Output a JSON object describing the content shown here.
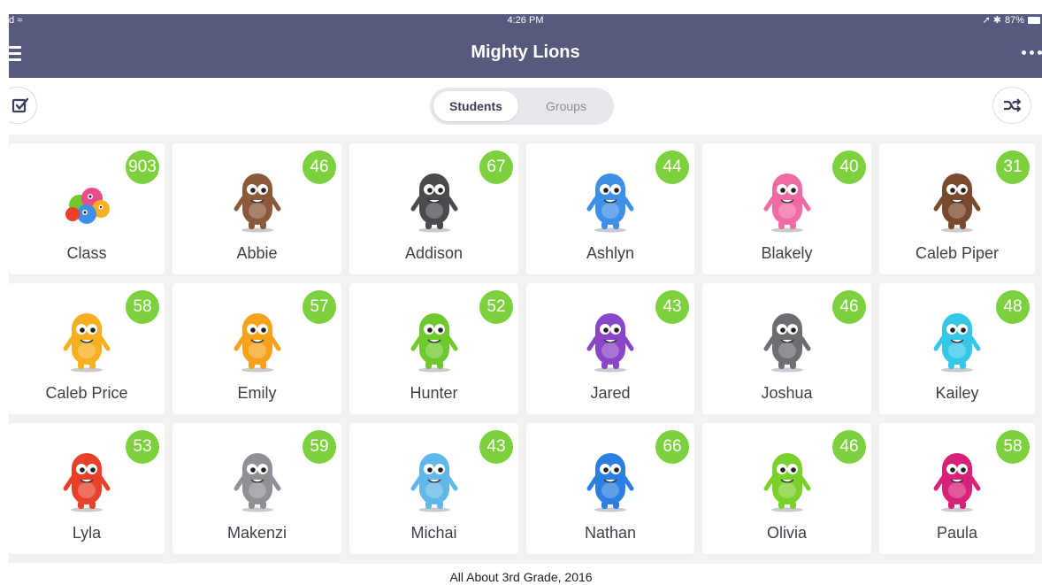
{
  "status_bar": {
    "carrier": "d",
    "wifi_glyph": "≈",
    "time": "4:26 PM",
    "battery": "87%",
    "indicators": "➚ ✱"
  },
  "header": {
    "title": "Mighty Lions",
    "menu_icon": "hamburger-icon",
    "more_icon": "ellipsis-icon"
  },
  "toolbar": {
    "left_icon": "checkbox-icon",
    "right_icon": "shuffle-icon",
    "tabs": [
      {
        "label": "Students",
        "selected": true
      },
      {
        "label": "Groups",
        "selected": false
      }
    ]
  },
  "colors": {
    "nav": "#565a7c",
    "badge": "#7ed13e",
    "background": "#f2f2f4"
  },
  "cards": [
    {
      "name": "Class",
      "points": "903",
      "avatar": "class-group",
      "color": "#e94b8c"
    },
    {
      "name": "Abbie",
      "points": "46",
      "avatar": "monster",
      "color": "#8a5a3a"
    },
    {
      "name": "Addison",
      "points": "67",
      "avatar": "monster",
      "color": "#4b4b4f"
    },
    {
      "name": "Ashlyn",
      "points": "44",
      "avatar": "monster",
      "color": "#3f8fe6"
    },
    {
      "name": "Blakely",
      "points": "40",
      "avatar": "monster",
      "color": "#f06aa4"
    },
    {
      "name": "Caleb Piper",
      "points": "31",
      "avatar": "monster",
      "color": "#7a4a2e"
    },
    {
      "name": "Caleb Price",
      "points": "58",
      "avatar": "monster",
      "color": "#f6b021"
    },
    {
      "name": "Emily",
      "points": "57",
      "avatar": "monster",
      "color": "#f7a21a"
    },
    {
      "name": "Hunter",
      "points": "52",
      "avatar": "monster",
      "color": "#6fc92c"
    },
    {
      "name": "Jared",
      "points": "43",
      "avatar": "monster",
      "color": "#8a46c8"
    },
    {
      "name": "Joshua",
      "points": "46",
      "avatar": "monster",
      "color": "#6d6d72"
    },
    {
      "name": "Kailey",
      "points": "48",
      "avatar": "monster",
      "color": "#36c7e8"
    },
    {
      "name": "Lyla",
      "points": "53",
      "avatar": "monster",
      "color": "#e9402a"
    },
    {
      "name": "Makenzi",
      "points": "59",
      "avatar": "monster",
      "color": "#8e9096"
    },
    {
      "name": "Michai",
      "points": "43",
      "avatar": "monster",
      "color": "#5fb8e9"
    },
    {
      "name": "Nathan",
      "points": "66",
      "avatar": "monster",
      "color": "#2b7fe0"
    },
    {
      "name": "Olivia",
      "points": "46",
      "avatar": "monster",
      "color": "#7bd12c"
    },
    {
      "name": "Paula",
      "points": "58",
      "avatar": "monster",
      "color": "#d8227a"
    }
  ],
  "caption": "All About 3rd Grade, 2016"
}
